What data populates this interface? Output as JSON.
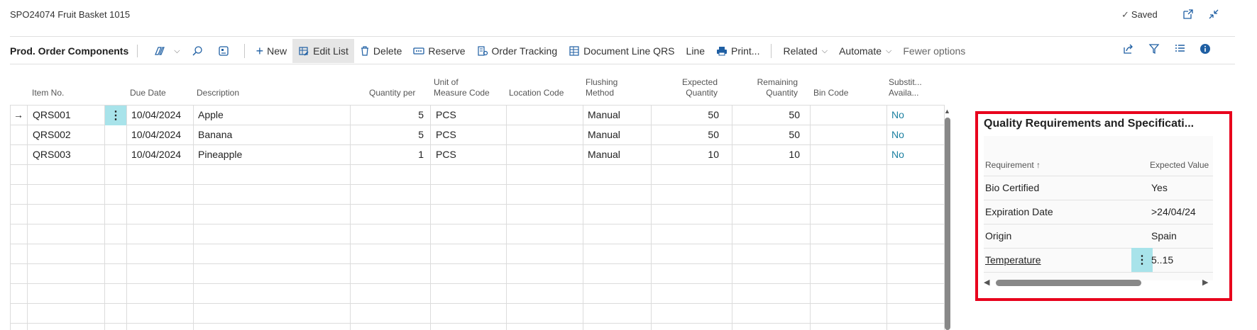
{
  "page": {
    "title": "SPO24074 Fruit Basket 1015",
    "saved_label": "Saved",
    "saved_icon": "check-icon",
    "open_new_icon": "open-in-new-window-icon",
    "collapse_icon": "collapse-icon"
  },
  "toolbar": {
    "title": "Prod. Order Components",
    "new": "New",
    "edit_list": "Edit List",
    "delete": "Delete",
    "reserve": "Reserve",
    "order_tracking": "Order Tracking",
    "document_line_qrs": "Document Line QRS",
    "line": "Line",
    "print": "Print...",
    "related": "Related",
    "automate": "Automate",
    "fewer_options": "Fewer options"
  },
  "grid": {
    "columns": {
      "item_no": "Item No.",
      "due_date": "Due Date",
      "description": "Description",
      "quantity_per": "Quantity per",
      "uom_1": "Unit of",
      "uom_2": "Measure Code",
      "location_code": "Location Code",
      "flushing_1": "Flushing",
      "flushing_2": "Method",
      "expected_1": "Expected",
      "expected_2": "Quantity",
      "remaining_1": "Remaining",
      "remaining_2": "Quantity",
      "bin_code": "Bin Code",
      "subst_1": "Substit...",
      "subst_2": "Availa..."
    },
    "rows": [
      {
        "item_no": "QRS001",
        "due_date": "10/04/2024",
        "description": "Apple",
        "quantity_per": "5",
        "uom": "PCS",
        "location": "",
        "flushing": "Manual",
        "expected": "50",
        "remaining": "50",
        "bin": "",
        "subst": "No"
      },
      {
        "item_no": "QRS002",
        "due_date": "10/04/2024",
        "description": "Banana",
        "quantity_per": "5",
        "uom": "PCS",
        "location": "",
        "flushing": "Manual",
        "expected": "50",
        "remaining": "50",
        "bin": "",
        "subst": "No"
      },
      {
        "item_no": "QRS003",
        "due_date": "10/04/2024",
        "description": "Pineapple",
        "quantity_per": "1",
        "uom": "PCS",
        "location": "",
        "flushing": "Manual",
        "expected": "10",
        "remaining": "10",
        "bin": "",
        "subst": "No"
      }
    ]
  },
  "factbox": {
    "title": "Quality Requirements and Specificati...",
    "col_requirement": "Requirement",
    "col_expected": "Expected Value",
    "sort_indicator": "↑",
    "rows": [
      {
        "requirement": "Bio Certified",
        "expected": "Yes"
      },
      {
        "requirement": "Expiration Date",
        "expected": ">24/04/24"
      },
      {
        "requirement": "Origin",
        "expected": "Spain"
      },
      {
        "requirement": "Temperature",
        "expected": "5..15"
      }
    ]
  },
  "colors": {
    "accent": "#1f5fa3",
    "selection": "#a8e3ea",
    "highlight_border": "#e8001c",
    "link": "#1a7fa0"
  }
}
